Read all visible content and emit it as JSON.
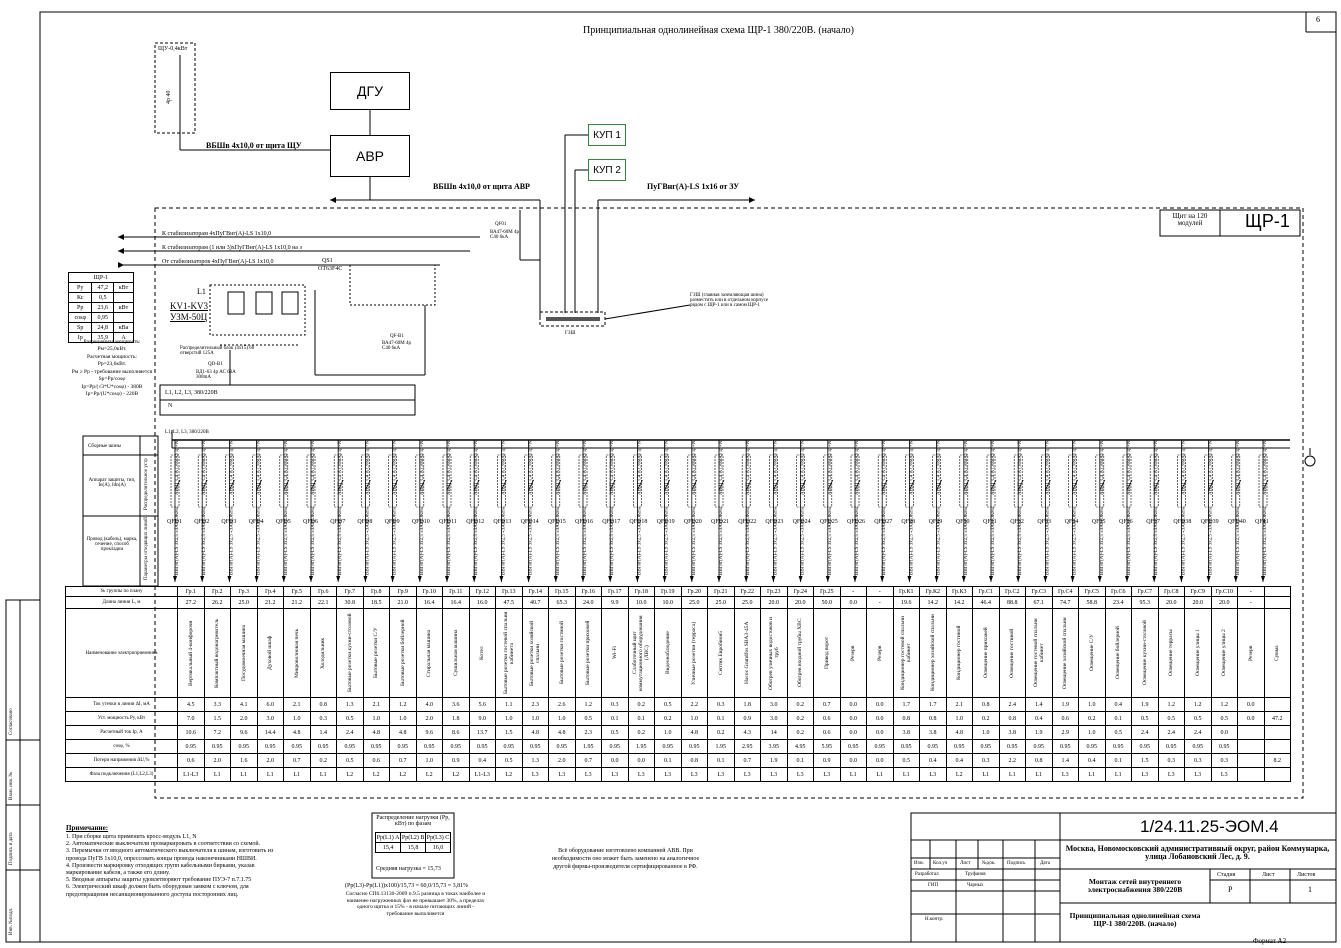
{
  "sheet": {
    "title": "Принципиальная однолинейная схема ЩР-1 380/220В. (начало)",
    "sheet_number": "6",
    "panel_name": "ЩР-1",
    "panel_note": "Щит на 120 модулей",
    "format": "Формат А2"
  },
  "top": {
    "shu_label": "ЩУ-0,4кВт",
    "shu_breaker": "4р 40",
    "dgu": "ДГУ",
    "avr": "АВР",
    "kup1": "КУП 1",
    "kup2": "КУП 2",
    "cable_from_shu": "ВБШв 4х10,0 от щита ЩУ",
    "cable_from_avr": "ВБШв 4х10,0 от щита АВР",
    "cable_from_zu": "ПуГВнг(А)-LS 1х16 от ЗУ",
    "stab1": "К стабилизаторам  4хПуГВнг(А)-LS 1х10,0",
    "stab2": "К стабилизаторам  (1 или 3)хПуГВнг(А)-LS 1х10,0 на з",
    "stab3": "От стабилизаторов  4хПуГВнг(А)-LS 1х10,0",
    "qs1": "QS1",
    "qs1_type": "OT63F4C",
    "qf_in": "QF01",
    "qf_in_type": "ВА47-60M 4р C40 6кА",
    "qf_b": "QF-B1",
    "qf_b_type": "ВА47-60M 4р C40 6кА",
    "kv": "KV1-KV3",
    "kv_type": "УЗМ-50Ц",
    "l1": "L1",
    "dist_block": "Распределительный блок (4х15) 60 отверстий 125А",
    "qd": "QD-B1",
    "qd_type": "ВД1-63 4р АС 63А 300mA",
    "busbar": "L1, L2, L3, 380/220В",
    "n": "N",
    "busbar2": "L1, L2, L3, 380/220В",
    "gzsh": "ГЗШ",
    "gzsh_note": "ГЗШ (главная заземляющая шина) разместить или в отдельном корпусе рядом с ЩР-1 или в самом ЩР-1"
  },
  "loads_table": {
    "header": "ЩР-1",
    "rows": [
      {
        "k": "Ру",
        "v": "47,2",
        "u": "кВт"
      },
      {
        "k": "Кс",
        "v": "0,5",
        "u": ""
      },
      {
        "k": "Рр",
        "v": "23,6",
        "u": "кВт"
      },
      {
        "k": "cosφ",
        "v": "0,95",
        "u": ""
      },
      {
        "k": "Sр",
        "v": "24,8",
        "u": "кВа"
      },
      {
        "k": "Iр",
        "v": "35,9",
        "u": "А"
      }
    ],
    "notes": [
      "Разрешенная мощность:",
      "Рм=25,0кВт.",
      "Расчетная мощность:",
      "Рр=23,6кВт.",
      "Рм ≥ Рр - требование выполняется",
      "Sр=Рр/cosφ",
      "Iр=Рр/(√3*U*cosφ) - 380В",
      "Iр=Рр/(U*cosφ) - 220В"
    ]
  },
  "row_labels": {
    "bus": "Сборные шины",
    "apparatus": "Аппарат защиты, тип, In(A), Idn(A)",
    "cable": "Провод (кабель), марка, сечение, способ прокладки",
    "group": "№ группы по плану",
    "length": "Длина линии L, м",
    "name": "Наименование электроприемника",
    "side_dist": "Распределительное устр",
    "side_lines": "Параметры отходящих линий",
    "side_receivers": "Электроприемники",
    "params": [
      "Ток утечки в линии ΔI, мА",
      "Уст. мощность Ру, кВт",
      "Расчетный ток Iр, А",
      "cosφ, %",
      "Потери напряжения ΔU,%",
      "Фаза подключения (L1,L2,L3)"
    ]
  },
  "feeders": [
    {
      "qf": "QFD1",
      "gr": "Гр.1",
      "len": "27.2",
      "name": "Вертикальный 4-конфорочн",
      "leak": "4.5",
      "p": "7.0",
      "i": "10.6",
      "cos": "0.95",
      "du": "0.6",
      "ph": "L1-L3"
    },
    {
      "qf": "QFD2",
      "gr": "Гр.2",
      "len": "26.2",
      "name": "Компактный водонагреватель",
      "leak": "3.3",
      "p": "1.5",
      "i": "7.2",
      "cos": "0.95",
      "du": "2.0",
      "ph": "L1"
    },
    {
      "qf": "QFD3",
      "gr": "Гр.3",
      "len": "25.0",
      "name": "Посудомоечная машина",
      "leak": "4.1",
      "p": "2.0",
      "i": "9.6",
      "cos": "0.95",
      "du": "1.6",
      "ph": "L1"
    },
    {
      "qf": "QFD4",
      "gr": "Гр.4",
      "len": "21.2",
      "name": "Духовой шкаф",
      "leak": "6.0",
      "p": "3.0",
      "i": "14.4",
      "cos": "0.95",
      "du": "2.0",
      "ph": "L1"
    },
    {
      "qf": "QFD5",
      "gr": "Гр.5",
      "len": "21.2",
      "name": "Микроволновая печь",
      "leak": "2.1",
      "p": "1.0",
      "i": "4.8",
      "cos": "0.95",
      "du": "0.7",
      "ph": "L1"
    },
    {
      "qf": "QFD6",
      "gr": "Гр.6",
      "len": "22.1",
      "name": "Холодильник",
      "leak": "0.8",
      "p": "0.3",
      "i": "1.4",
      "cos": "0.95",
      "du": "0.2",
      "ph": "L1"
    },
    {
      "qf": "QFD7",
      "gr": "Гр.7",
      "len": "30.8",
      "name": "Бытовые розетки кухни-столовой",
      "leak": "1.3",
      "p": "0.5",
      "i": "2.4",
      "cos": "0.95",
      "du": "0.5",
      "ph": "L2"
    },
    {
      "qf": "QFD8",
      "gr": "Гр.8",
      "len": "18.5",
      "name": "Бытовые розетки С/У",
      "leak": "2.1",
      "p": "1.0",
      "i": "4.8",
      "cos": "0.95",
      "du": "0.6",
      "ph": "L2"
    },
    {
      "qf": "QFD9",
      "gr": "Гр.9",
      "len": "21.0",
      "name": "Бытовые розетки бойлерной",
      "leak": "1.2",
      "p": "1.0",
      "i": "4.8",
      "cos": "0.95",
      "du": "0.7",
      "ph": "L2"
    },
    {
      "qf": "QFD10",
      "gr": "Гр.10",
      "len": "16.4",
      "name": "Стиральная машина",
      "leak": "4.0",
      "p": "2.0",
      "i": "9.6",
      "cos": "0.95",
      "du": "1.0",
      "ph": "L2"
    },
    {
      "qf": "QFD11",
      "gr": "Гр.11",
      "len": "16.4",
      "name": "Сушильная машина",
      "leak": "3.6",
      "p": "1.8",
      "i": "8.6",
      "cos": "0.95",
      "du": "0.9",
      "ph": "L2"
    },
    {
      "qf": "QFD12",
      "gr": "Гр.12",
      "len": "16.0",
      "name": "Котел",
      "leak": "5.6",
      "p": "9.0",
      "i": "13.7",
      "cos": "0.95",
      "du": "0.4",
      "ph": "L1-L3"
    },
    {
      "qf": "QFD13",
      "gr": "Гр.13",
      "len": "47.5",
      "name": "Бытовые розетки гостевой спальни кабинета",
      "leak": "1.1",
      "p": "1.0",
      "i": "1.5",
      "cos": "0.95",
      "du": "0.5",
      "ph": "L2"
    },
    {
      "qf": "QFD14",
      "gr": "Гр.14",
      "len": "40.7",
      "name": "Бытовые розетки хозяйской спальни",
      "leak": "2.3",
      "p": "1.0",
      "i": "4.8",
      "cos": "0.95",
      "du": "1.3",
      "ph": "L3"
    },
    {
      "qf": "QFD15",
      "gr": "Гр.15",
      "len": "65.3",
      "name": "Бытовые розетки гостиной",
      "leak": "2.6",
      "p": "1.0",
      "i": "4.8",
      "cos": "0.95",
      "du": "2.0",
      "ph": "L3"
    },
    {
      "qf": "QFD16",
      "gr": "Гр.16",
      "len": "24.0",
      "name": "Бытовые розетки прихожей",
      "leak": "1.2",
      "p": "0.5",
      "i": "2.3",
      "cos": "1.95",
      "du": "0.7",
      "ph": "L3"
    },
    {
      "qf": "QFD17",
      "gr": "Гр.17",
      "len": "9.9",
      "name": "Wi-Fi",
      "leak": "0.3",
      "p": "0.1",
      "i": "0.5",
      "cos": "0.95",
      "du": "0.0",
      "ph": "L3"
    },
    {
      "qf": "QFD18",
      "gr": "Гр.18",
      "len": "10.0",
      "name": "Слаботочный щит коммутационного оборудования (ЛВС)",
      "leak": "0.2",
      "p": "0.1",
      "i": "0.2",
      "cos": "1.95",
      "du": "0.0",
      "ph": "L3"
    },
    {
      "qf": "QFD19",
      "gr": "Гр.19",
      "len": "10.0",
      "name": "Видеонаблюдение",
      "leak": "0.5",
      "p": "0.2",
      "i": "1.0",
      "cos": "0.95",
      "du": "0.1",
      "ph": "L3"
    },
    {
      "qf": "QFD20",
      "gr": "Гр.20",
      "len": "25.0",
      "name": "Уличные розетки (терраса)",
      "leak": "2.2",
      "p": "1.0",
      "i": "4.8",
      "cos": "0.95",
      "du": "0.8",
      "ph": "L3"
    },
    {
      "qf": "QFD21",
      "gr": "Гр.21",
      "len": "25.0",
      "name": "Септик Евробион5",
      "leak": "0.3",
      "p": "0.1",
      "i": "0.2",
      "cos": "1.95",
      "du": "0.1",
      "ph": "L3"
    },
    {
      "qf": "QFD22",
      "gr": "Гр.22",
      "len": "25.0",
      "name": "Насос Grundfos SBA3-45A",
      "leak": "1.8",
      "p": "0.9",
      "i": "4.3",
      "cos": "2.95",
      "du": "0.7",
      "ph": "L3"
    },
    {
      "qf": "QFD23",
      "gr": "Гр.23",
      "len": "20.0",
      "name": "Обогрев уличных водостоков и труб",
      "leak": "3.0",
      "p": "3.0",
      "i": "14",
      "cos": "3.95",
      "du": "1.9",
      "ph": "L3"
    },
    {
      "qf": "QFD24",
      "gr": "Гр.24",
      "len": "20.0",
      "name": "Обогрев входной трубы ХВС",
      "leak": "0.2",
      "p": "0.2",
      "i": "0.2",
      "cos": "4.95",
      "du": "0.1",
      "ph": "L3"
    },
    {
      "qf": "QFD25",
      "gr": "Гр.25",
      "len": "50.0",
      "name": "Привод ворот",
      "leak": "0.7",
      "p": "0.6",
      "i": "0.6",
      "cos": "5.95",
      "du": "0.9",
      "ph": "L3"
    },
    {
      "qf": "QFD26",
      "gr": "-",
      "len": "0.0",
      "name": "Резерв",
      "leak": "0.0",
      "p": "0.0",
      "i": "0.0",
      "cos": "0.95",
      "du": "0.0",
      "ph": "L1"
    },
    {
      "qf": "QFD27",
      "gr": "-",
      "len": "-",
      "name": "Резерв",
      "leak": "0.0",
      "p": "0.0",
      "i": "0.0",
      "cos": "0.95",
      "du": "0.0",
      "ph": "L1"
    },
    {
      "qf": "QF28",
      "gr": "Гр.К1",
      "len": "19.6",
      "name": "Кондиционер гостевой спальни кабинет",
      "leak": "1.7",
      "p": "0.8",
      "i": "3.8",
      "cos": "0.95",
      "du": "0.5",
      "ph": "L1"
    },
    {
      "qf": "QF29",
      "gr": "Гр.К2",
      "len": "14.2",
      "name": "Кондиционер хозяйской спальни",
      "leak": "1.7",
      "p": "0.8",
      "i": "3.8",
      "cos": "0.95",
      "du": "0.4",
      "ph": "L3"
    },
    {
      "qf": "QF30",
      "gr": "Гр.К3",
      "len": "14.2",
      "name": "Кондиционер гостиной",
      "leak": "2.1",
      "p": "1.0",
      "i": "4.8",
      "cos": "0.95",
      "du": "0.4",
      "ph": "L2"
    },
    {
      "qf": "QF31",
      "gr": "Гр.С1",
      "len": "46.4",
      "name": "Освещение прихожей",
      "leak": "0.8",
      "p": "0.2",
      "i": "1.0",
      "cos": "0.95",
      "du": "0.3",
      "ph": "L1"
    },
    {
      "qf": "QF32",
      "gr": "Гр.С2",
      "len": "88.8",
      "name": "Освещение гостиной",
      "leak": "2.4",
      "p": "0.8",
      "i": "3.8",
      "cos": "0.95",
      "du": "2.2",
      "ph": "L1"
    },
    {
      "qf": "QF33",
      "gr": "Гр.С3",
      "len": "67.1",
      "name": "Освещение гостевой спальни кабинет",
      "leak": "1.4",
      "p": "0.4",
      "i": "1.9",
      "cos": "0.95",
      "du": "0.8",
      "ph": "L1"
    },
    {
      "qf": "QF34",
      "gr": "Гр.С4",
      "len": "74.7",
      "name": "Освещение хозяйской спальни",
      "leak": "1.9",
      "p": "0.6",
      "i": "2.9",
      "cos": "0.95",
      "du": "1.4",
      "ph": "L3"
    },
    {
      "qf": "QF35",
      "gr": "Гр.С5",
      "len": "58.8",
      "name": "Освещение С/У",
      "leak": "1.0",
      "p": "0.2",
      "i": "1.0",
      "cos": "0.95",
      "du": "0.4",
      "ph": "L1"
    },
    {
      "qf": "QF36",
      "gr": "Гр.С6",
      "len": "23.4",
      "name": "Освещение бойлерной",
      "leak": "0.4",
      "p": "0.1",
      "i": "0.5",
      "cos": "0.95",
      "du": "0.1",
      "ph": "L1"
    },
    {
      "qf": "QF37",
      "gr": "Гр.С7",
      "len": "95.3",
      "name": "Освещение кухни-столовой",
      "leak": "1.9",
      "p": "0.5",
      "i": "2.4",
      "cos": "0.95",
      "du": "1.5",
      "ph": "L3"
    },
    {
      "qf": "QFD38",
      "gr": "Гр.С8",
      "len": "20.0",
      "name": "Освещение террасы",
      "leak": "1.2",
      "p": "0.5",
      "i": "2.4",
      "cos": "0.95",
      "du": "0.3",
      "ph": "L3"
    },
    {
      "qf": "QFD39",
      "gr": "Гр.С9",
      "len": "20.0",
      "name": "Освещение улицы 1",
      "leak": "1.2",
      "p": "0.5",
      "i": "2.4",
      "cos": "0.95",
      "du": "0.3",
      "ph": "L3"
    },
    {
      "qf": "QFD40",
      "gr": "Гр.С10",
      "len": "20.0",
      "name": "Освещение улицы 2",
      "leak": "1.2",
      "p": "0.5",
      "i": "0.0",
      "cos": "0.95",
      "du": "0.3",
      "ph": "L3"
    },
    {
      "qf": "QF41",
      "gr": "-",
      "len": "-",
      "name": "Резерв",
      "leak": "0.0",
      "p": "0.0",
      "i": "",
      "cos": "",
      "du": "",
      "ph": ""
    },
    {
      "qf": "",
      "gr": "",
      "len": "",
      "name": "Сумма",
      "leak": "",
      "p": "47.2",
      "i": "",
      "cos": "",
      "du": "8.2",
      "ph": ""
    }
  ],
  "apparatus_label": "АВДТ С4 А (30мА) 1р+N",
  "cable_label": "ВВГнг(А)-LS 3х2,5 «ЗАМОКН»",
  "phase_dist": {
    "title": "Распределение нагрузки (Рр, кВт) по фазам",
    "heads": [
      "Рр(L1) A",
      "Рр(L2) B",
      "Рр(L3) C"
    ],
    "vals": [
      "15,4",
      "15,8",
      "16,0"
    ],
    "avg": "Средняя нагрузка = 15,73",
    "formula": "(Рр(L3)-Рр(L1))х100)/15,73 = 60,0/15,73 = 3,81%",
    "formula_note": "Согласно СП6.13130-2009 п.9.5 разница в токах наиболее и наименее нагруженных фаз не превышает 30%, а пределах одного щитка и 15% - в начале питающих линий - требование выполняется"
  },
  "equipment_note": "Всё оборудование изготовлено компанией ABB. При необходимости оно может быть заменено на аналогичное другой фирмы-производителя сертифицированное в РФ.",
  "notes": {
    "title": "Примечание:",
    "lines": [
      "1. При сборке щита применить кросс-модуль L1, N",
      "2. Автоматические выключатели промаркировать в соответствии со схемой.",
      "3. Перемычки от вводного автоматического выключателя к шинам, изготовить из провода ПуГВ 1х10,0, опрессовать концы провода наконечниками НШВИ.",
      "4. Произвести маркировку отходящих групп кабельными бирками, указав маркирование кабеля, а также его длину.",
      "5. Вводные аппараты защиты удовлетворяют требование ПУЭ-7 п.7.1.75",
      "6. Электрический шкаф должен быть оборудован замком с ключом, для предотвращения несанкционированного доступа посторонних лиц."
    ]
  },
  "stamp": {
    "code": "1/24.11.25-ЭОМ.4",
    "address": "Москва, Новомосковский административный округ, район Коммунарка, улица Лобановский Лес, д. 9.",
    "object": "Монтаж сетей внутреннего электроснабжения 380/220В",
    "sheet_title": "Принципиальная однолинейная схема ЩР-1 380/220В. (начало)",
    "stage_h": "Стадия",
    "sheet_h": "Лист",
    "sheets_h": "Листов",
    "stage": "Р",
    "sheet": "",
    "sheets": "1",
    "cols": [
      "Изм.",
      "Кол.уч",
      "Лист",
      "№док.",
      "Подпись",
      "Дата"
    ],
    "role1": "Разработал",
    "name1": "Труфанов",
    "role2": "ГИП",
    "name2": "Чарных",
    "role3": "Н.контр.",
    "name3": ""
  },
  "left_stamp": [
    "Согласовано",
    "Взам. инв. №",
    "Подпись и дата",
    "Инв. №подл."
  ]
}
